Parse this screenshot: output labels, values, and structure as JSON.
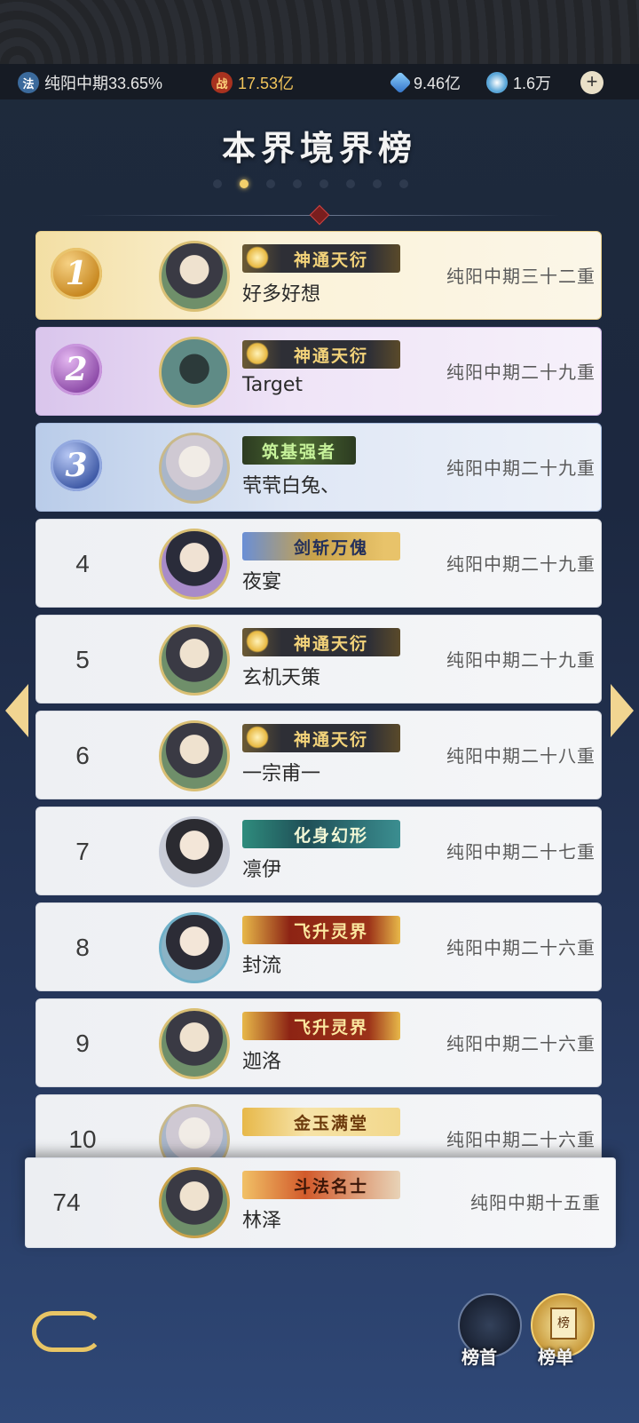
{
  "resources": {
    "cultivation": "纯阳中期33.65%",
    "combat_power": "17.53亿",
    "spirit_stone": "9.46亿",
    "currency": "1.6万",
    "combat_icon_char": "战",
    "cultivation_icon_char": "法",
    "add_icon": "+"
  },
  "page": {
    "title": "本界境界榜",
    "page_dots": 8,
    "active_dot": 1
  },
  "ranking": [
    {
      "rank": "1",
      "name": "好多好想",
      "title": "神通天衍",
      "realm": "纯阳中期三十二重"
    },
    {
      "rank": "2",
      "name": "Target",
      "title": "神通天衍",
      "realm": "纯阳中期二十九重"
    },
    {
      "rank": "3",
      "name": "茕茕白兔、",
      "title": "筑基强者",
      "realm": "纯阳中期二十九重"
    },
    {
      "rank": "4",
      "name": "夜宴",
      "title": "剑斩万傀",
      "realm": "纯阳中期二十九重"
    },
    {
      "rank": "5",
      "name": "玄机天策",
      "title": "神通天衍",
      "realm": "纯阳中期二十九重"
    },
    {
      "rank": "6",
      "name": "一宗甫一",
      "title": "神通天衍",
      "realm": "纯阳中期二十八重"
    },
    {
      "rank": "7",
      "name": "凛伊",
      "title": "化身幻形",
      "realm": "纯阳中期二十七重"
    },
    {
      "rank": "8",
      "name": "封流",
      "title": "飞升灵界",
      "realm": "纯阳中期二十六重"
    },
    {
      "rank": "9",
      "name": "迦洛",
      "title": "飞升灵界",
      "realm": "纯阳中期二十六重"
    },
    {
      "rank": "10",
      "name": "",
      "title": "金玉满堂",
      "realm": "纯阳中期二十六重"
    }
  ],
  "self": {
    "rank": "74",
    "name": "林泽",
    "title": "斗法名士",
    "realm": "纯阳中期十五重"
  },
  "bottom": {
    "top_label": "榜首",
    "list_label": "榜单",
    "list_icon_char": "榜"
  }
}
